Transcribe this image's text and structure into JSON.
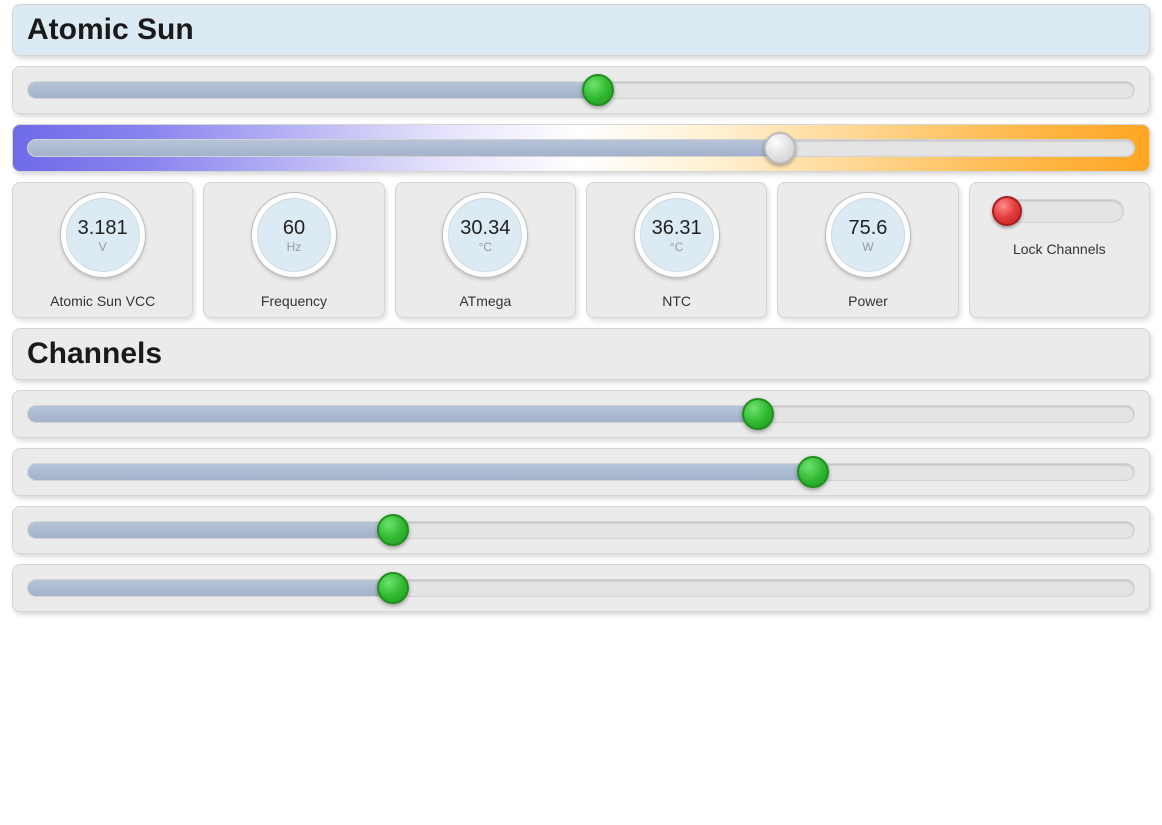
{
  "header1": {
    "title": "Atomic Sun"
  },
  "slider_main": {
    "percent": 51.5
  },
  "slider_ct": {
    "percent": 68
  },
  "gauges": [
    {
      "value": "3.181",
      "unit": "V",
      "label": "Atomic Sun VCC"
    },
    {
      "value": "60",
      "unit": "Hz",
      "label": "Frequency"
    },
    {
      "value": "30.34",
      "unit": "°C",
      "label": "ATmega"
    },
    {
      "value": "36.31",
      "unit": "°C",
      "label": "NTC"
    },
    {
      "value": "75.6",
      "unit": "W",
      "label": "Power"
    }
  ],
  "lock": {
    "label": "Lock Channels",
    "on": false
  },
  "header2": {
    "title": "Channels"
  },
  "channels": [
    {
      "percent": 66
    },
    {
      "percent": 71
    },
    {
      "percent": 33
    },
    {
      "percent": 33
    }
  ]
}
